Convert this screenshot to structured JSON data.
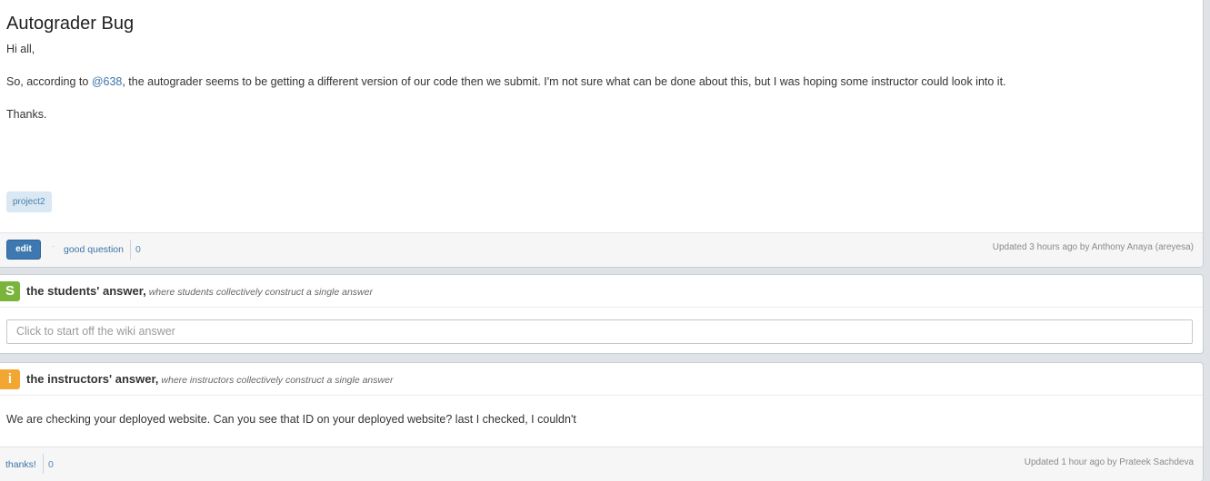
{
  "question": {
    "title": "Autograder Bug",
    "greeting": "Hi all,",
    "body_before_link": "So, according to ",
    "body_link": "@638",
    "body_after_link": ", the autograder seems to be getting a different version of our code then we submit. I'm not sure what can be done about this, but I was hoping some instructor could look into it.",
    "closing": "Thanks.",
    "tag": "project2",
    "edit_label": "edit",
    "dot": "·",
    "good_question_label": "good question",
    "good_question_count": "0",
    "updated_prefix": "Updated 3 hours ago by ",
    "updated_author": "Anthony Anaya (areyesa)"
  },
  "students_answer": {
    "badge": "S",
    "title": "the students' answer,",
    "subtitle": "where students collectively construct a single answer",
    "input_placeholder": "Click to start off the wiki answer"
  },
  "instructors_answer": {
    "badge": "i",
    "title": "the instructors' answer,",
    "subtitle": "where instructors collectively construct a single answer",
    "body": "We are checking your deployed website. Can you see that ID on your deployed website? last I checked, I couldn't",
    "thanks_label": "thanks!",
    "thanks_count": "0",
    "updated_prefix": "Updated 1 hour ago by ",
    "updated_author": "Prateek Sachdeva"
  },
  "colors": {
    "accent_blue": "#3d79b0",
    "student_green": "#79b53b",
    "instructor_orange": "#f3a732"
  }
}
